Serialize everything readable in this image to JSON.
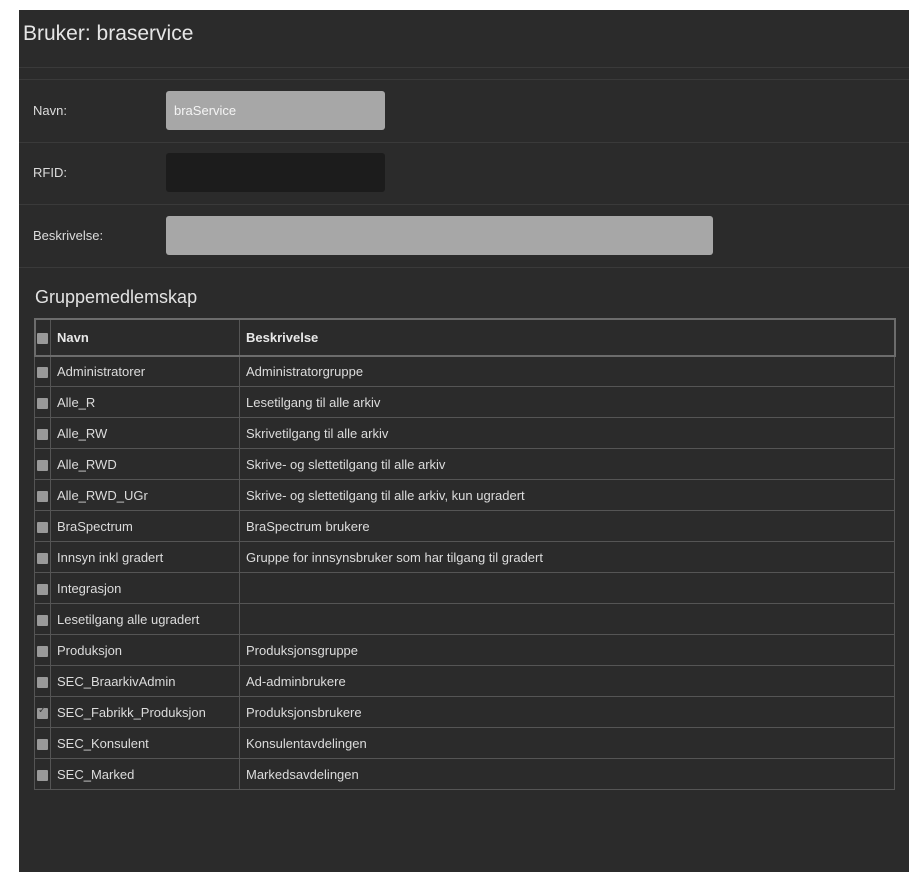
{
  "page": {
    "title": "Bruker: braservice"
  },
  "form": {
    "navn_label": "Navn:",
    "navn_value": "braService",
    "rfid_label": "RFID:",
    "rfid_value": "",
    "beskrivelse_label": "Beskrivelse:",
    "beskrivelse_value": ""
  },
  "groups": {
    "section_title": "Gruppemedlemskap",
    "headers": {
      "name": "Navn",
      "description": "Beskrivelse"
    },
    "header_checked": false,
    "rows": [
      {
        "name": "Administratorer",
        "description": "Administratorgruppe",
        "checked": false
      },
      {
        "name": "Alle_R",
        "description": "Lesetilgang til alle arkiv",
        "checked": false
      },
      {
        "name": "Alle_RW",
        "description": "Skrivetilgang til alle arkiv",
        "checked": false
      },
      {
        "name": "Alle_RWD",
        "description": "Skrive- og slettetilgang til alle arkiv",
        "checked": false
      },
      {
        "name": "Alle_RWD_UGr",
        "description": "Skrive- og slettetilgang til alle arkiv, kun ugradert",
        "checked": false
      },
      {
        "name": "BraSpectrum",
        "description": "BraSpectrum brukere",
        "checked": false
      },
      {
        "name": "Innsyn inkl gradert",
        "description": "Gruppe for innsynsbruker som har tilgang til gradert",
        "checked": false
      },
      {
        "name": "Integrasjon",
        "description": "",
        "checked": false
      },
      {
        "name": "Lesetilgang alle ugradert",
        "description": "",
        "checked": false
      },
      {
        "name": "Produksjon",
        "description": "Produksjonsgruppe",
        "checked": false
      },
      {
        "name": "SEC_BraarkivAdmin",
        "description": "Ad-adminbrukere",
        "checked": false
      },
      {
        "name": "SEC_Fabrikk_Produksjon",
        "description": "Produksjonsbrukere",
        "checked": true
      },
      {
        "name": "SEC_Konsulent",
        "description": "Konsulentavdelingen",
        "checked": false
      },
      {
        "name": "SEC_Marked",
        "description": "Markedsavdelingen",
        "checked": false
      }
    ]
  },
  "colors": {
    "panel_bg": "#2b2b2b",
    "field_light": "#a7a7a7",
    "field_dark": "#1c1c1c",
    "checkbox": "#999999"
  }
}
